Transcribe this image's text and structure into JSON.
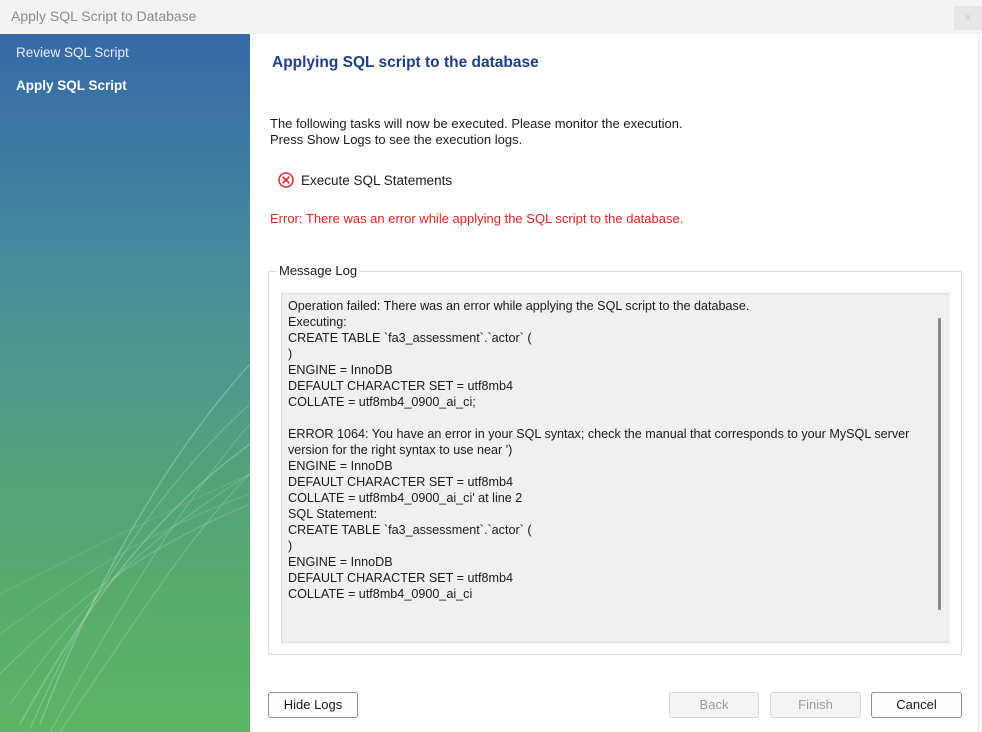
{
  "window": {
    "title": "Apply SQL Script to Database",
    "close_label": "×"
  },
  "sidebar": {
    "items": [
      {
        "label": "Review SQL Script",
        "active": false
      },
      {
        "label": "Apply SQL Script",
        "active": true
      }
    ]
  },
  "main": {
    "heading": "Applying SQL script to the database",
    "intro_line1": "The following tasks will now be executed. Please monitor the execution.",
    "intro_line2": "Press Show Logs to see the execution logs.",
    "task": {
      "label": "Execute SQL Statements",
      "status_icon": "error-circle-icon"
    },
    "error_message": "Error: There was an error while applying the SQL script to the database.",
    "message_log": {
      "legend": "Message Log",
      "text": "Operation failed: There was an error while applying the SQL script to the database.\nExecuting:\nCREATE TABLE `fa3_assessment`.`actor` (\n)\nENGINE = InnoDB\nDEFAULT CHARACTER SET = utf8mb4\nCOLLATE = utf8mb4_0900_ai_ci;\n\nERROR 1064: You have an error in your SQL syntax; check the manual that corresponds to your MySQL server version for the right syntax to use near ')\nENGINE = InnoDB\nDEFAULT CHARACTER SET = utf8mb4\nCOLLATE = utf8mb4_0900_ai_ci' at line 2\nSQL Statement:\nCREATE TABLE `fa3_assessment`.`actor` (\n)\nENGINE = InnoDB\nDEFAULT CHARACTER SET = utf8mb4\nCOLLATE = utf8mb4_0900_ai_ci"
    }
  },
  "footer": {
    "hide_logs": "Hide Logs",
    "back": "Back",
    "finish": "Finish",
    "cancel": "Cancel"
  },
  "colors": {
    "heading": "#1f3f86",
    "error": "#e0241e",
    "sidebar_top": "#3569a6",
    "sidebar_bottom": "#5db466"
  }
}
